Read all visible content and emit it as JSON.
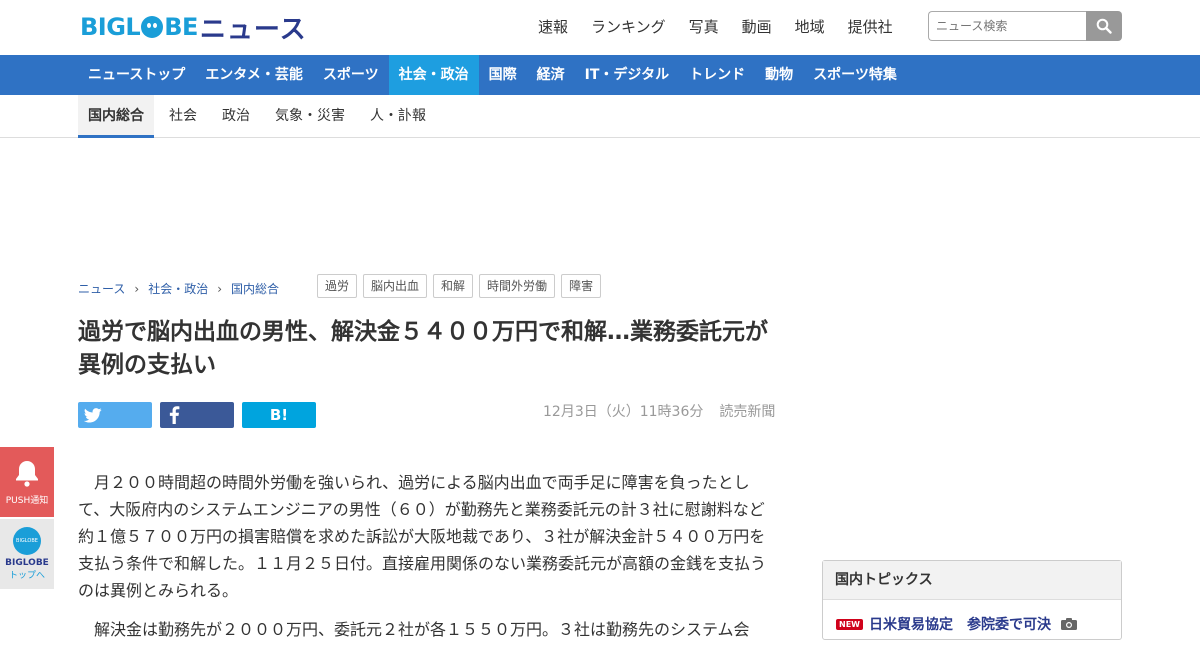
{
  "header": {
    "logo_brand": "BIGL",
    "logo_brand_tail": "BE",
    "logo_news": "ニュース",
    "top_links": [
      "速報",
      "ランキング",
      "写真",
      "動画",
      "地域",
      "提供社"
    ],
    "search_placeholder": "ニュース検索"
  },
  "nav": {
    "items": [
      "ニューストップ",
      "エンタメ・芸能",
      "スポーツ",
      "社会・政治",
      "国際",
      "経済",
      "IT・デジタル",
      "トレンド",
      "動物",
      "スポーツ特集"
    ],
    "active": "社会・政治"
  },
  "subnav": {
    "items": [
      "国内総合",
      "社会",
      "政治",
      "気象・災害",
      "人・訃報"
    ],
    "active": "国内総合"
  },
  "breadcrumb": [
    "ニュース",
    "社会・政治",
    "国内総合"
  ],
  "tags": [
    "過労",
    "脳内出血",
    "和解",
    "時間外労働",
    "障害"
  ],
  "article": {
    "headline": "過労で脳内出血の男性、解決金５４００万円で和解…業務委託元が異例の支払い",
    "date": "12月3日（火）11時36分",
    "source": "読売新聞",
    "hatena_label": "B!",
    "paragraphs": [
      "　月２００時間超の時間外労働を強いられ、過労による脳内出血で両手足に障害を負ったとして、大阪府内のシステムエンジニアの男性（６０）が勤務先と業務委託元の計３社に慰謝料など約１億５７００万円の損害賠償を求めた訴訟が大阪地裁であり、３社が解決金計５４００万円を支払う条件で和解した。１１月２５日付。直接雇用関係のない業務委託元が高額の金銭を支払うのは異例とみられる。",
      "　解決金は勤務先が２０００万円、委託元２社が各１５５０万円。３社は勤務先のシステム会"
    ]
  },
  "sidebar": {
    "topics_title": "国内トピックス",
    "new_badge": "NEW",
    "topic_item": "日米貿易協定　参院委で可決"
  },
  "float": {
    "push_label": "PUSH通知",
    "biglobe_icon_text": "BIGLOBE",
    "biglobe_label": "BIGLOBE",
    "biglobe_sub": "トップへ"
  },
  "colors": {
    "brand": "#1a9ed8",
    "nav_bg": "#2f72c4",
    "nav_active": "#1e9ee0",
    "twitter": "#55acee",
    "facebook": "#3b5998",
    "hatena": "#00a4de",
    "push": "#e35a5a"
  }
}
